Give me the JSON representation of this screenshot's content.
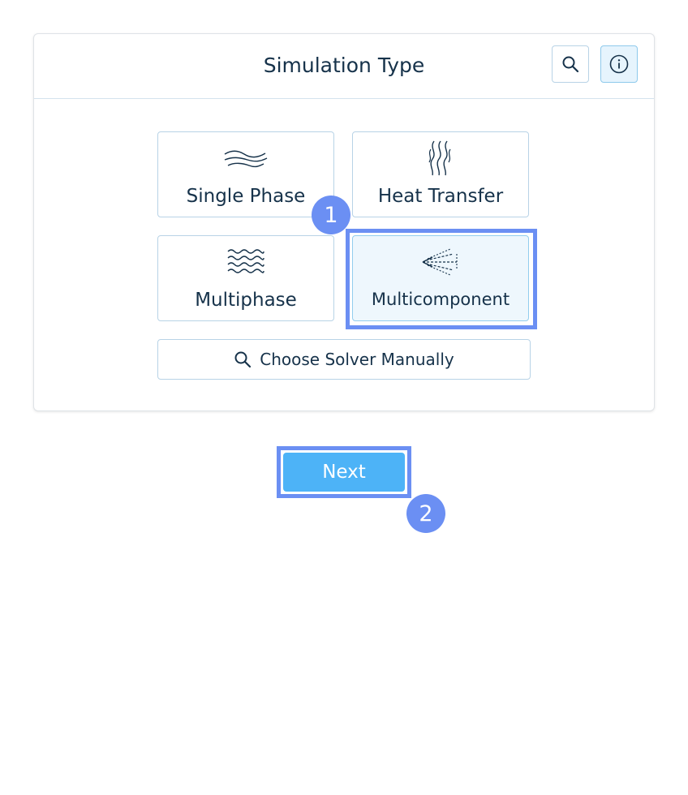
{
  "panel": {
    "title": "Simulation Type",
    "search_icon": "search-icon",
    "info_icon": "info-icon"
  },
  "tiles": [
    {
      "label": "Single Phase",
      "icon": "wave-lines-icon",
      "selected": false
    },
    {
      "label": "Heat Transfer",
      "icon": "heat-flame-icon",
      "selected": false
    },
    {
      "label": "Multiphase",
      "icon": "water-waves-icon",
      "selected": false
    },
    {
      "label": "Multicomponent",
      "icon": "spray-icon",
      "selected": true
    }
  ],
  "manual": {
    "label": "Choose Solver Manually",
    "icon": "search-icon"
  },
  "next": {
    "label": "Next"
  },
  "badges": [
    "1",
    "2"
  ],
  "colors": {
    "text": "#16324a",
    "accent_blue": "#4db3f7",
    "annotation": "#6b8ff3",
    "tile_border": "#b8d3e6"
  }
}
